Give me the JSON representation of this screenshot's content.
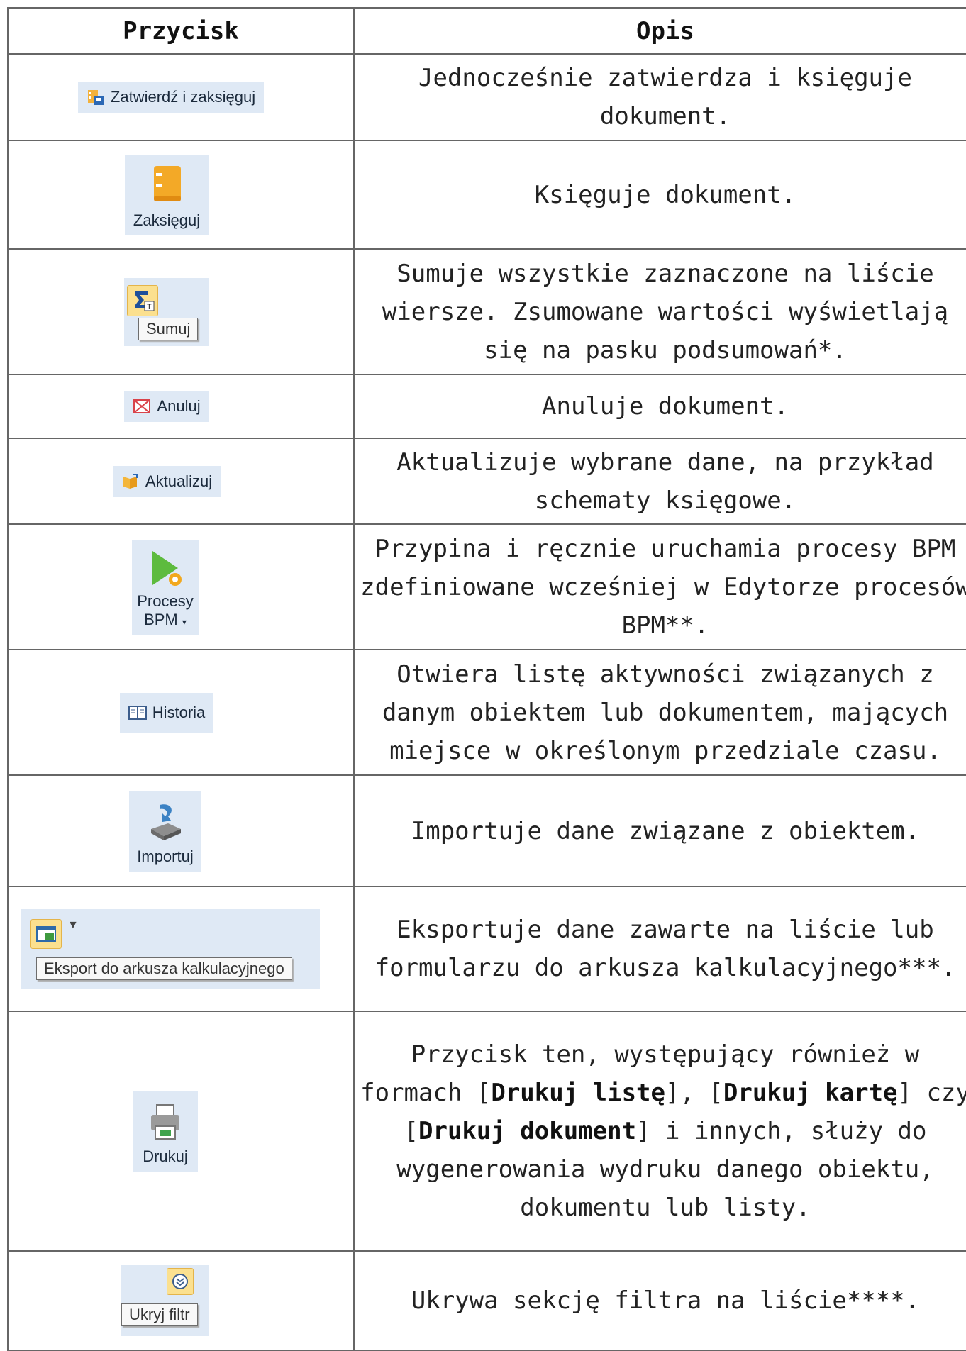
{
  "header": {
    "col1": "Przycisk",
    "col2": "Opis"
  },
  "rows": [
    {
      "button": "Zatwierdź i zaksięguj",
      "desc": "Jednocześnie zatwierdza i księguje dokument."
    },
    {
      "button": "Zaksięguj",
      "desc": "Księguje dokument."
    },
    {
      "button": "Sumuj",
      "desc": "Sumuje wszystkie zaznaczone na liście wiersze. Zsumowane wartości wyświetlają się na pasku podsumowań*."
    },
    {
      "button": "Anuluj",
      "desc": "Anuluje dokument."
    },
    {
      "button": "Aktualizuj",
      "desc": "Aktualizuje wybrane dane, na przykład schematy księgowe."
    },
    {
      "button_line1": "Procesy",
      "button_line2": "BPM",
      "desc": "Przypina i ręcznie uruchamia procesy BPM zdefiniowane wcześniej w Edytorze procesów BPM**."
    },
    {
      "button": "Historia",
      "desc": "Otwiera listę aktywności związanych z danym obiektem lub dokumentem, mających miejsce w określonym przedziale czasu."
    },
    {
      "button": "Importuj",
      "desc": "Importuje dane związane z obiektem."
    },
    {
      "button": "Eksport do arkusza kalkulacyjnego",
      "desc": "Eksportuje dane zawarte na liście lub formularzu do arkusza kalkulacyjnego***."
    },
    {
      "button": "Drukuj",
      "desc_a": "Przycisk ten, występujący również w formach [",
      "bold1": "Drukuj listę",
      "desc_b": "], [",
      "bold2": "Drukuj kartę",
      "desc_c": "] czy",
      "desc_d": "[",
      "bold3": "Drukuj dokument",
      "desc_e": "] i innych, służy do wygenerowania wydruku danego obiektu, dokumentu lub listy."
    },
    {
      "button": "Ukryj filtr",
      "desc": "Ukrywa sekcję filtra na liście****."
    }
  ]
}
